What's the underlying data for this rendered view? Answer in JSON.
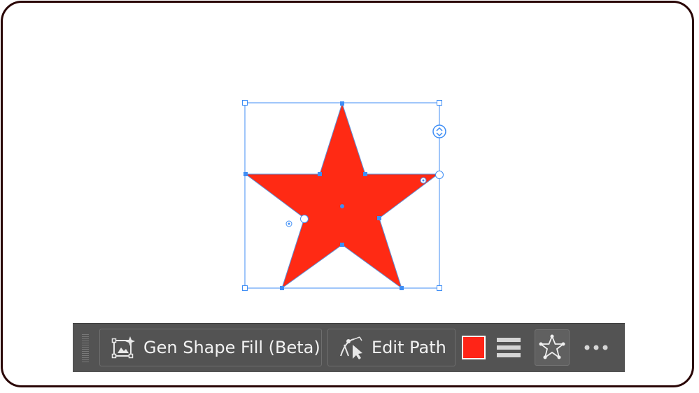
{
  "canvas": {
    "shape_name": "star",
    "fill_color": "#ff2a14",
    "selection_color": "#3f8ef5"
  },
  "toolbar": {
    "gen_shape_fill_label": "Gen Shape Fill (Beta)",
    "gen_shape_fill_icon": "gen-shape-fill-icon",
    "edit_path_label": "Edit Path",
    "edit_path_icon": "pen-path-icon",
    "fill_swatch_color": "#ff2417",
    "stroke_menu_icon": "hamburger-icon",
    "shape_options_icon": "star-outline-icon",
    "more_icon": "ellipsis-icon"
  }
}
